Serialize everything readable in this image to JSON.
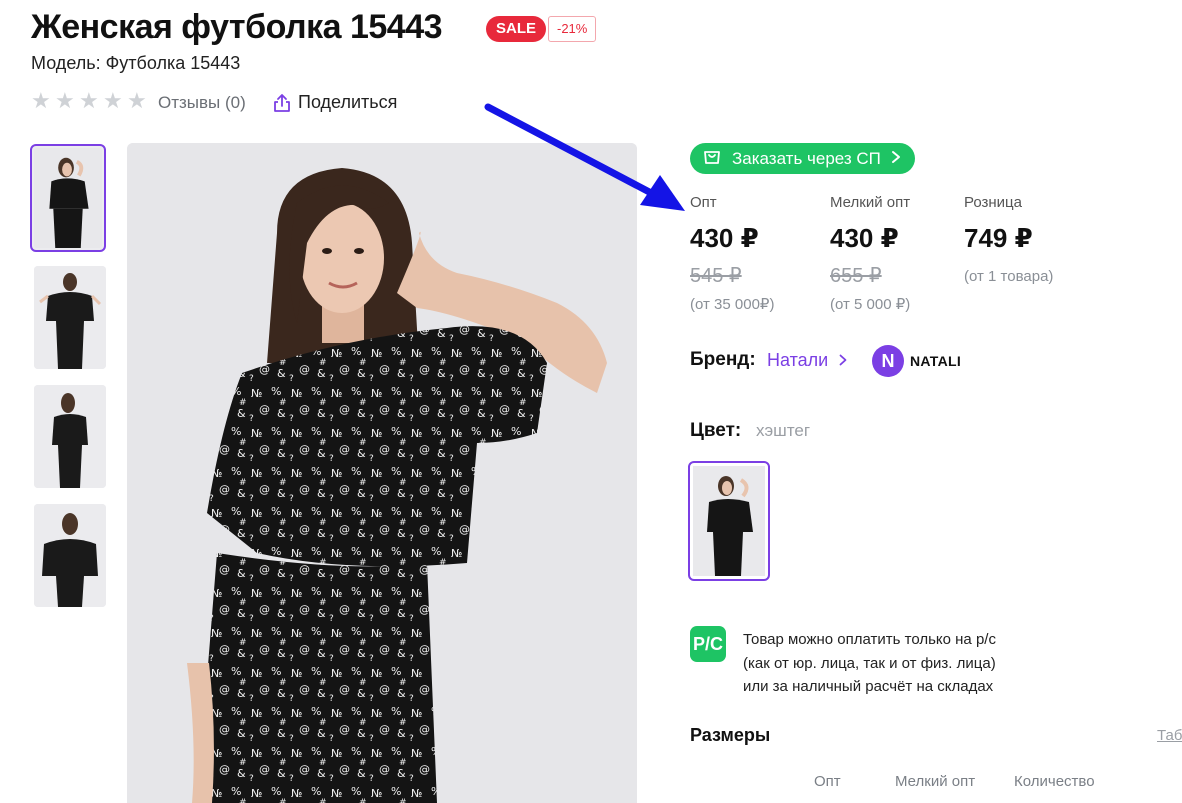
{
  "product": {
    "title": "Женская футболка 15443",
    "sale_badge": "SALE",
    "discount_badge": "-21%",
    "model": "Модель: Футболка 15443"
  },
  "rating": {
    "stars": 0,
    "reviews_label": "Отзывы (0)",
    "share_label": "Поделиться"
  },
  "gallery": {
    "thumbnails": 4,
    "active_index": 0
  },
  "order_button": {
    "label": "Заказать через СП"
  },
  "prices": [
    {
      "label": "Опт",
      "price": "430 ₽",
      "old_price": "545 ₽",
      "note": "(от 35 000₽)"
    },
    {
      "label": "Мелкий опт",
      "price": "430 ₽",
      "old_price": "655 ₽",
      "note": "(от 5 000 ₽)"
    },
    {
      "label": "Розница",
      "price": "749 ₽",
      "old_price": "",
      "note": "(от 1 товара)"
    }
  ],
  "brand": {
    "label": "Бренд:",
    "link": "Натали",
    "logo_letter": "N",
    "logo_text": "NATALI"
  },
  "color": {
    "label": "Цвет:",
    "value": "хэштег"
  },
  "payment": {
    "icon_text": "Р/С",
    "lines": [
      "Товар можно оплатить только на р/с",
      "(как от юр. лица, так и от физ. лица)",
      "или за наличный расчёт на складах"
    ]
  },
  "sizes": {
    "title": "Размеры",
    "table_link": "Таб",
    "columns": [
      "Опт",
      "Мелкий опт",
      "Количество"
    ]
  },
  "colors": {
    "accent": "#7b3fe4",
    "green": "#1ec464",
    "sale": "#e8293b",
    "arrow": "#1414e6"
  },
  "icons": [
    "star-icon",
    "share-icon",
    "cart-icon",
    "chevron-right-icon",
    "arrow-annotation"
  ]
}
